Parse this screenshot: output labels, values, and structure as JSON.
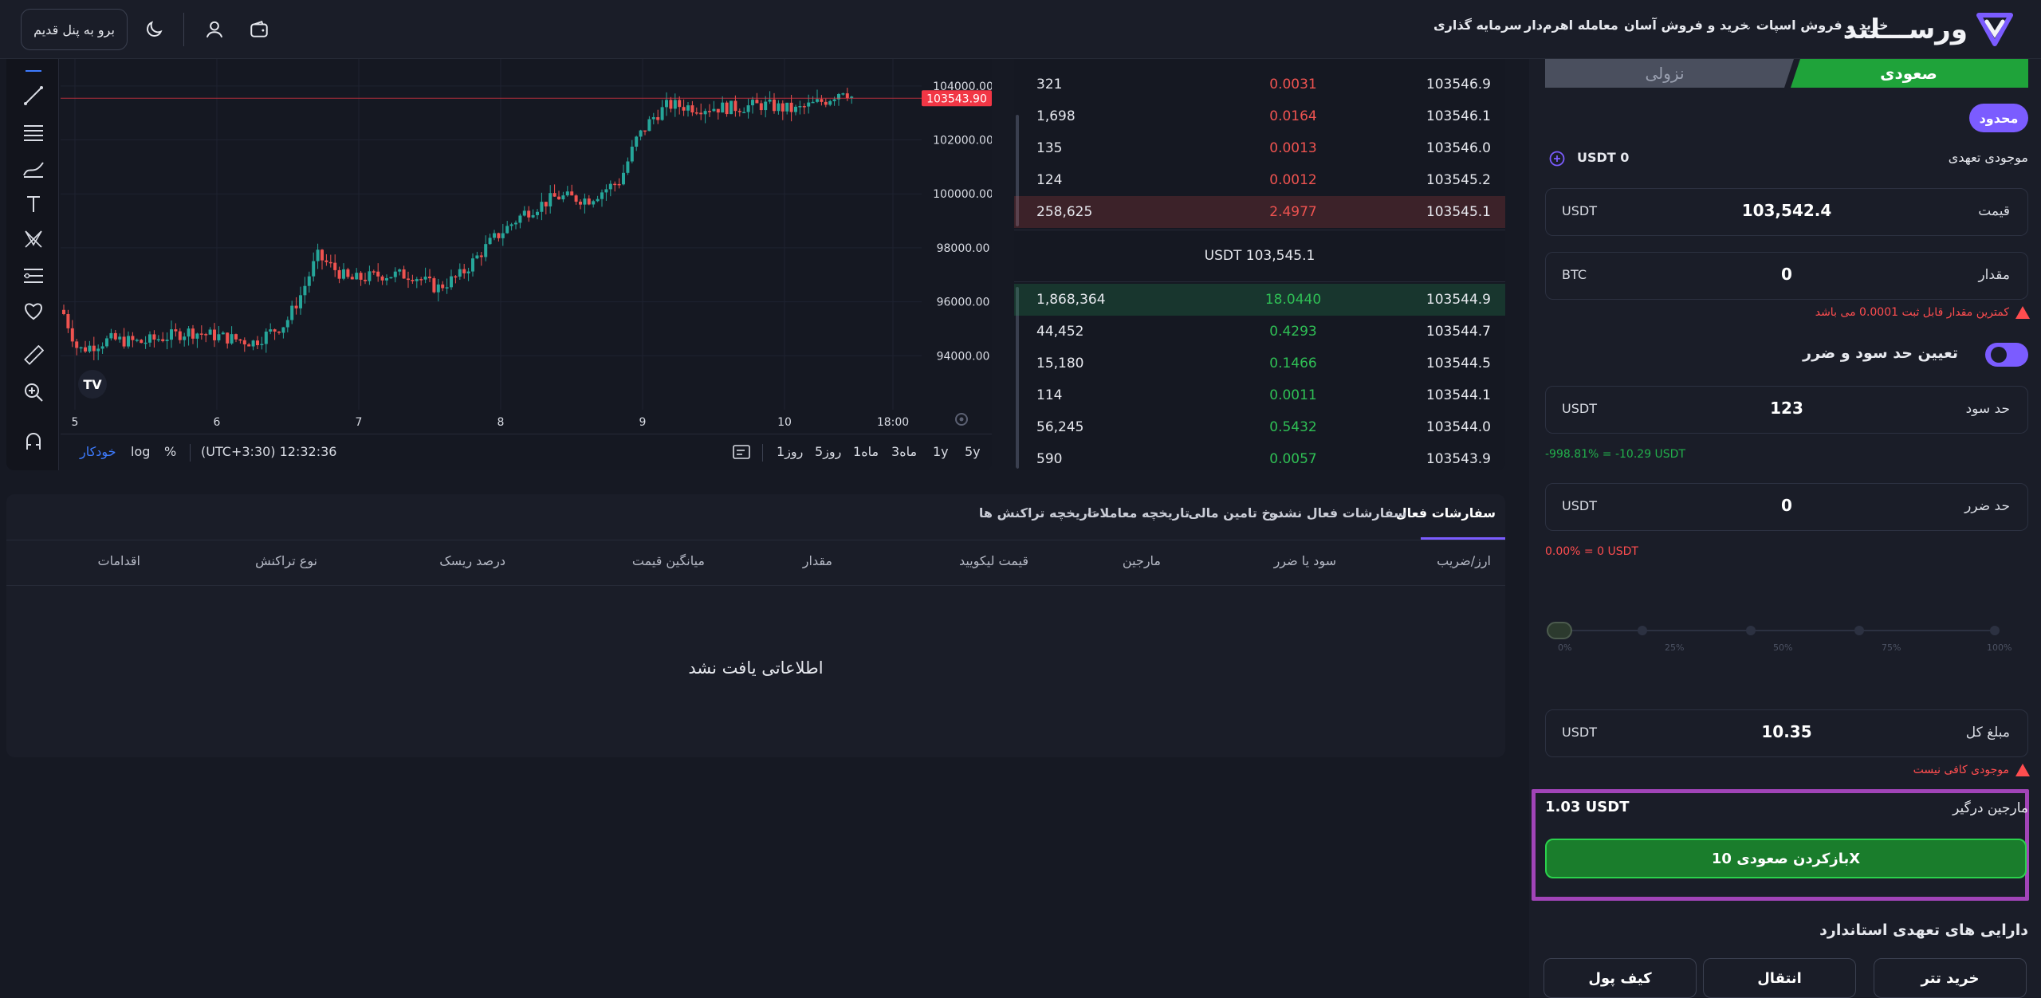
{
  "header": {
    "brand": "ورســـلند",
    "old_panel_label": "برو به پنل قدیم",
    "nav": [
      "خرید و فروش اسپات",
      "خرید و فروش آسان",
      "معامله اهرم‌دار",
      "سرمایه گذاری"
    ],
    "nav_dropdown_icon": "chevron-down-icon"
  },
  "chart": {
    "last_price_tag": "103543.90",
    "price_axis": [
      "104000.00",
      "102000.00",
      "100000.00",
      "98000.00",
      "96000.00",
      "94000.00"
    ],
    "time_axis": [
      "5",
      "6",
      "7",
      "8",
      "9",
      "10",
      "18:00"
    ],
    "timeframes": [
      "5y",
      "1y",
      "3ماه",
      "1ماه",
      "5روز",
      "1روز"
    ],
    "clock": "(UTC+3:30) 12:32:36",
    "options": [
      "%",
      "log",
      "خودکار"
    ],
    "colors": {
      "up": "#26a69a",
      "down": "#ef5350",
      "price_tag": "#f23645"
    }
  },
  "orderbook": {
    "asks": [
      {
        "amount": "321",
        "volume": "0.0031",
        "price": "103546.9",
        "depth": 0
      },
      {
        "amount": "1,698",
        "volume": "0.0164",
        "price": "103546.1",
        "depth": 0
      },
      {
        "amount": "135",
        "volume": "0.0013",
        "price": "103546.0",
        "depth": 0
      },
      {
        "amount": "124",
        "volume": "0.0012",
        "price": "103545.2",
        "depth": 0
      },
      {
        "amount": "258,625",
        "volume": "2.4977",
        "price": "103545.1",
        "depth": 1
      }
    ],
    "mid_price": "USDT 103,545.1",
    "bids": [
      {
        "amount": "1,868,364",
        "volume": "18.0440",
        "price": "103544.9",
        "depth": 1
      },
      {
        "amount": "44,452",
        "volume": "0.4293",
        "price": "103544.7",
        "depth": 0
      },
      {
        "amount": "15,180",
        "volume": "0.1466",
        "price": "103544.5",
        "depth": 0
      },
      {
        "amount": "114",
        "volume": "0.0011",
        "price": "103544.1",
        "depth": 0
      },
      {
        "amount": "56,245",
        "volume": "0.5432",
        "price": "103544.0",
        "depth": 0
      },
      {
        "amount": "590",
        "volume": "0.0057",
        "price": "103543.9",
        "depth": 0
      }
    ]
  },
  "orders": {
    "tabs": [
      "سفارشات فعال",
      "سفارشات فعال نشده",
      "نرخ تامین مالی",
      "تاریخچه معاملات",
      "تاریخچه تراکنش ها"
    ],
    "columns": [
      "ارز/ضریب",
      "سود یا ضرر",
      "مارجین",
      "قیمت لیکویید",
      "مقدار",
      "میانگین قیمت",
      "درصد ریسک",
      "نوع تراکنش",
      "اقدامات"
    ],
    "empty_message": "اطلاعاتی یافت نشد"
  },
  "trade": {
    "side_long": "صعودی",
    "side_short": "نزولی",
    "order_type": "محدود",
    "committed_balance_label": "موجودی تعهدی",
    "committed_balance_value": "USDT 0",
    "price_label": "قیمت",
    "price_value": "103,542.4",
    "price_unit": "USDT",
    "amount_label": "مقدار",
    "amount_value": "0",
    "amount_unit": "BTC",
    "min_amount_warning": "کمترین مقدار قابل ثبت 0.0001 می باشد",
    "tp_sl_toggle_label": "تعیین حد سود و ضرر",
    "tp_sl_enabled": true,
    "take_profit_label": "حد سود",
    "take_profit_value": "123",
    "take_profit_unit": "USDT",
    "take_profit_pnl": "-998.81%  =  -10.29 USDT",
    "stop_loss_label": "حد ضرر",
    "stop_loss_value": "0",
    "stop_loss_unit": "USDT",
    "stop_loss_pnl": "0.00%  =  0 USDT",
    "slider_value_pct": 0,
    "slider_marks": [
      "0%",
      "25%",
      "50%",
      "75%",
      "100%"
    ],
    "total_label": "مبلغ کل",
    "total_value": "10.35",
    "total_unit": "USDT",
    "insufficient_warning": "موجودی کافی نیست",
    "margin_label": "مارجین درگیر",
    "margin_value": "1.03 USDT",
    "open_long_button": "بازکردن صعودی 10X",
    "standard_assets_label": "دارایی های تعهدی استاندارد",
    "asset_buttons": [
      "خرید تتر",
      "انتقال",
      "کیف پول"
    ],
    "colors": {
      "accent": "#7b5cff",
      "long": "#1fa33a",
      "short": "#4a4f5e",
      "highlight": "#a144b8"
    }
  }
}
